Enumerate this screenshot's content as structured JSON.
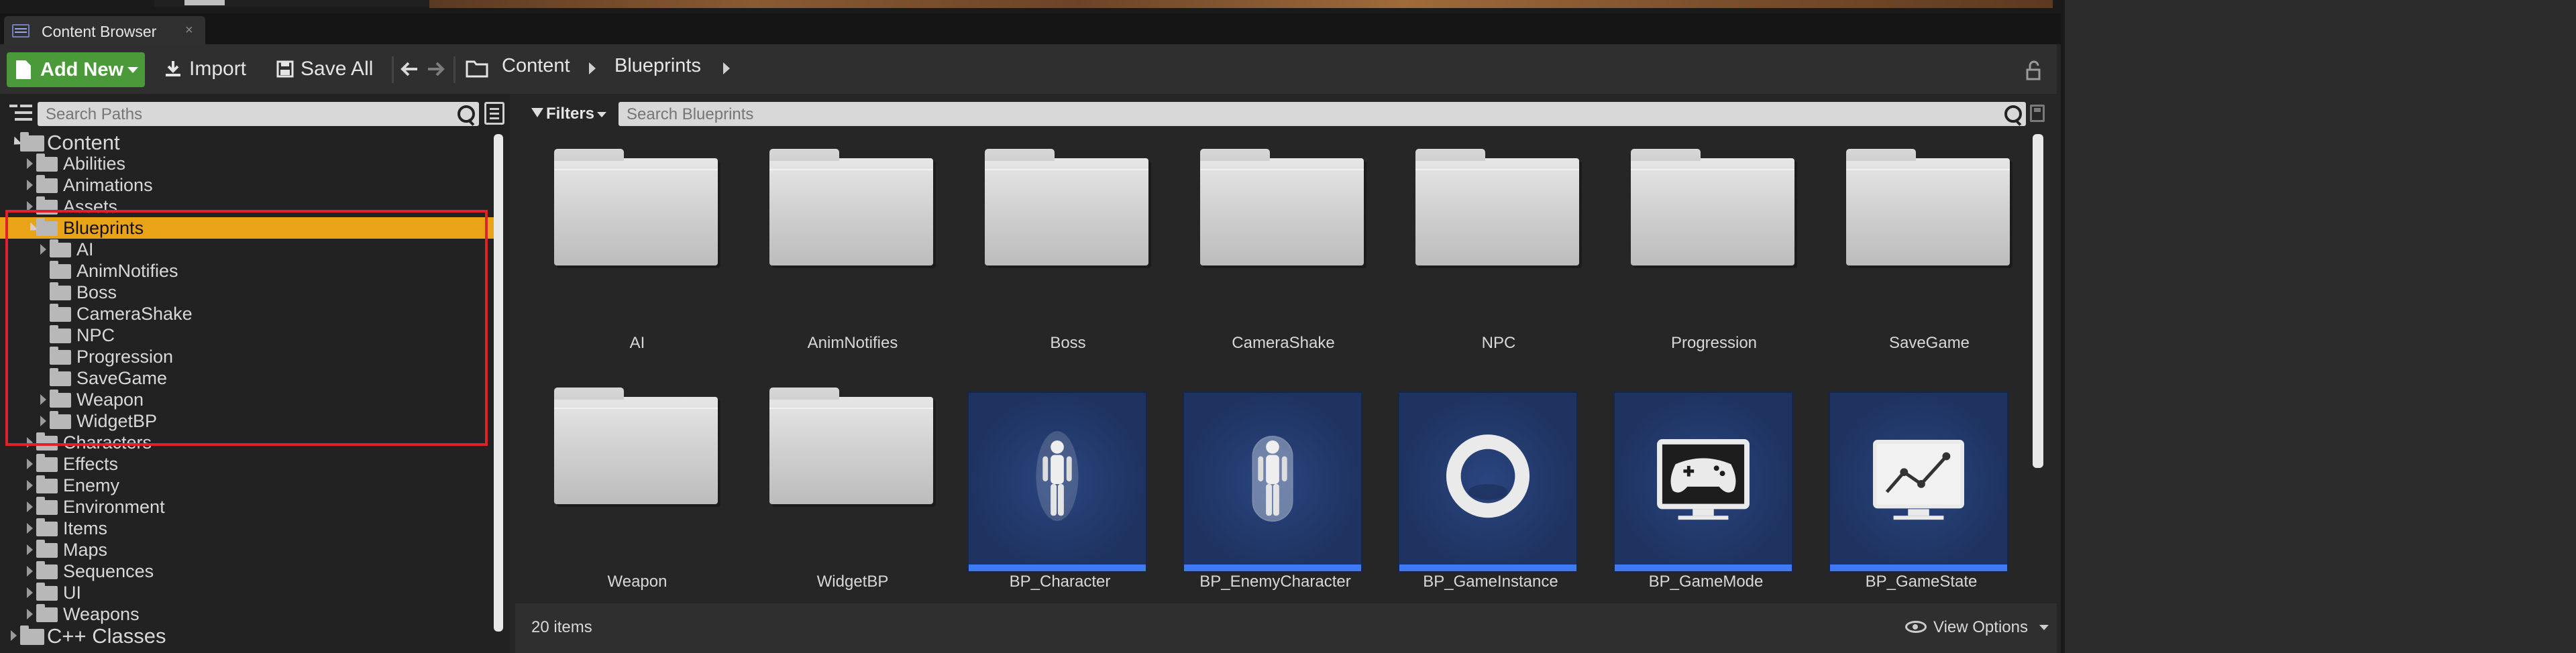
{
  "window": {
    "tab_title": "Content Browser",
    "tab_close": "×"
  },
  "toolbar": {
    "add_new": "Add New",
    "import": "Import",
    "save_all": "Save All",
    "breadcrumbs": [
      "Content",
      "Blueprints"
    ]
  },
  "sources": {
    "search_placeholder": "Search Paths",
    "tree": [
      {
        "label": "Content",
        "depth": 0,
        "expanded": true,
        "root": true
      },
      {
        "label": "Abilities",
        "depth": 1,
        "has_children": true
      },
      {
        "label": "Animations",
        "depth": 1,
        "has_children": true
      },
      {
        "label": "Assets",
        "depth": 1,
        "has_children": true
      },
      {
        "label": "Blueprints",
        "depth": 1,
        "expanded": true,
        "selected": true
      },
      {
        "label": "AI",
        "depth": 2,
        "has_children": true
      },
      {
        "label": "AnimNotifies",
        "depth": 2
      },
      {
        "label": "Boss",
        "depth": 2
      },
      {
        "label": "CameraShake",
        "depth": 2
      },
      {
        "label": "NPC",
        "depth": 2
      },
      {
        "label": "Progression",
        "depth": 2
      },
      {
        "label": "SaveGame",
        "depth": 2
      },
      {
        "label": "Weapon",
        "depth": 2,
        "has_children": true
      },
      {
        "label": "WidgetBP",
        "depth": 2,
        "has_children": true
      },
      {
        "label": "Characters",
        "depth": 1,
        "has_children": true
      },
      {
        "label": "Effects",
        "depth": 1,
        "has_children": true
      },
      {
        "label": "Enemy",
        "depth": 1,
        "has_children": true
      },
      {
        "label": "Environment",
        "depth": 1,
        "has_children": true
      },
      {
        "label": "Items",
        "depth": 1,
        "has_children": true
      },
      {
        "label": "Maps",
        "depth": 1,
        "has_children": true
      },
      {
        "label": "Sequences",
        "depth": 1,
        "has_children": true
      },
      {
        "label": "UI",
        "depth": 1,
        "has_children": true
      },
      {
        "label": "Weapons",
        "depth": 1,
        "has_children": true
      },
      {
        "label": "C++ Classes",
        "depth": 0,
        "has_children": true,
        "root": true
      }
    ]
  },
  "assets": {
    "filters_label": "Filters",
    "search_placeholder": "Search Blueprints",
    "items": [
      {
        "name": "AI",
        "kind": "folder"
      },
      {
        "name": "AnimNotifies",
        "kind": "folder"
      },
      {
        "name": "Boss",
        "kind": "folder"
      },
      {
        "name": "CameraShake",
        "kind": "folder"
      },
      {
        "name": "NPC",
        "kind": "folder"
      },
      {
        "name": "Progression",
        "kind": "folder"
      },
      {
        "name": "SaveGame",
        "kind": "folder"
      },
      {
        "name": "Weapon",
        "kind": "folder"
      },
      {
        "name": "WidgetBP",
        "kind": "folder"
      },
      {
        "name": "BP_Character",
        "kind": "asset",
        "icon": "mannequin-icon"
      },
      {
        "name": "BP_EnemyCharacter",
        "kind": "asset",
        "icon": "mannequin-capsule-icon"
      },
      {
        "name": "BP_GameInstance",
        "kind": "asset",
        "icon": "ring-icon"
      },
      {
        "name": "BP_GameMode",
        "kind": "asset",
        "icon": "gamepad-monitor-icon"
      },
      {
        "name": "BP_GameState",
        "kind": "asset",
        "icon": "graph-monitor-icon"
      }
    ],
    "item_count_text": "20 items",
    "view_options": "View Options"
  },
  "colors": {
    "add_new_green": "#4a9a3a",
    "selection_orange": "#e8a317",
    "highlight_red": "#e0202a",
    "asset_card_blue": "#1f3564",
    "asset_strip_blue": "#3d7cf0"
  }
}
